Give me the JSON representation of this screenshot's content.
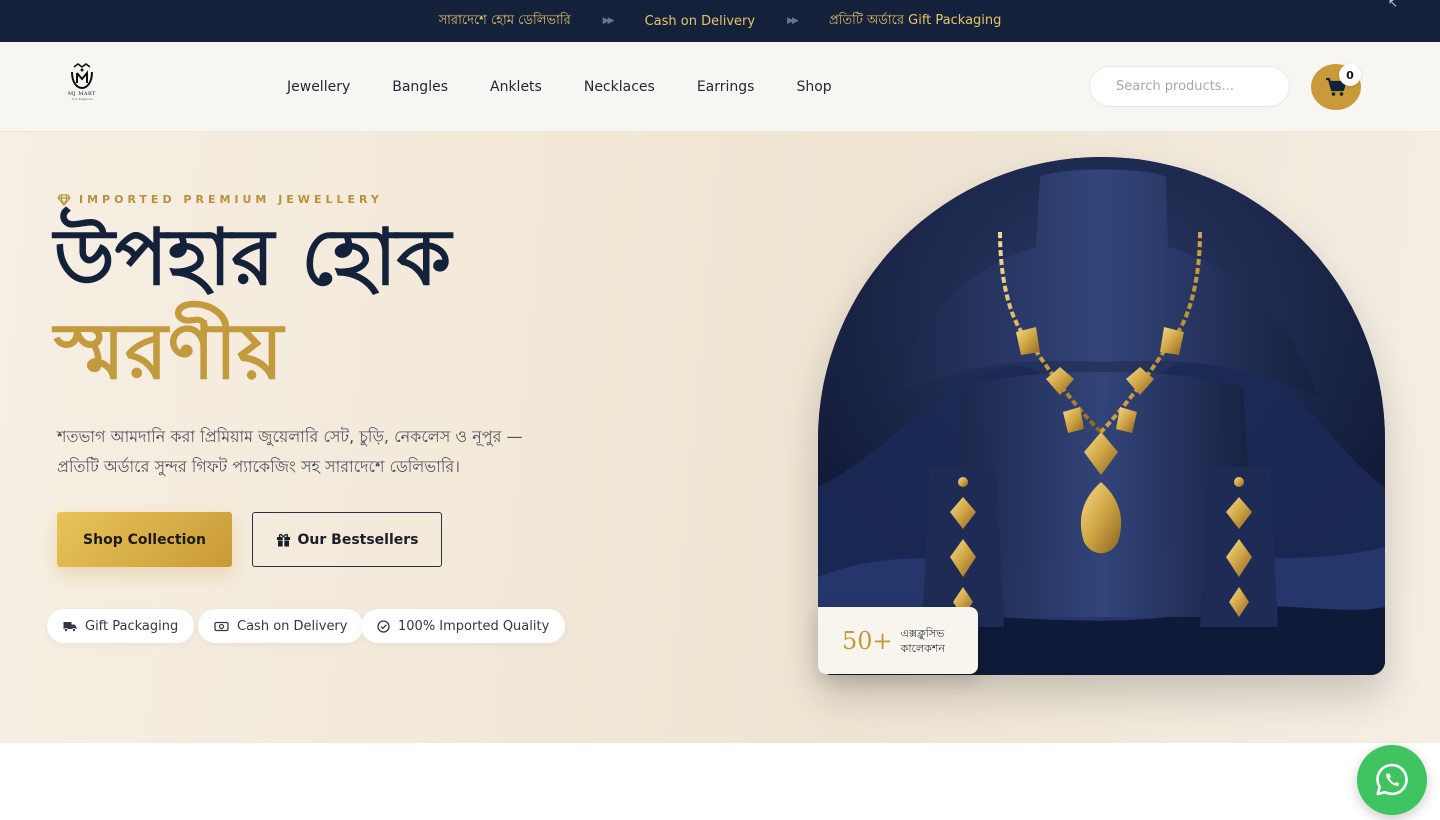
{
  "topbar": {
    "messages": [
      "সারাদেশে হোম ডেলিভারি",
      "Cash on Delivery",
      "প্রতিটি অর্ডারে Gift Packaging"
    ]
  },
  "header": {
    "logo_title": "MJ MART",
    "logo_sub": "Your Elegance",
    "nav": [
      "Jewellery",
      "Bangles",
      "Anklets",
      "Necklaces",
      "Earrings",
      "Shop"
    ],
    "search_placeholder": "Search products...",
    "cart_count": "0"
  },
  "hero": {
    "eyebrow": "IMPORTED PREMIUM JEWELLERY",
    "title_line1": "উপহার হোক",
    "title_line2": "স্মরণীয়",
    "description": "শতভাগ আমদানি করা প্রিমিয়াম জুয়েলারি সেট, চুড়ি, নেকলেস ও নূপুর — প্রতিটি অর্ডারে সুন্দর গিফট প্যাকেজিং সহ সারাদেশে ডেলিভারি।",
    "cta_primary": "Shop Collection",
    "cta_secondary": "Our Bestsellers",
    "chips": [
      "Gift Packaging",
      "Cash on Delivery",
      "100% Imported Quality"
    ],
    "stat_number": "50+",
    "stat_label_line1": "এক্সক্লুসিভ",
    "stat_label_line2": "কালেকশন"
  },
  "colors": {
    "navy": "#14213a",
    "gold": "#c39a3e",
    "whatsapp": "#40c361"
  }
}
